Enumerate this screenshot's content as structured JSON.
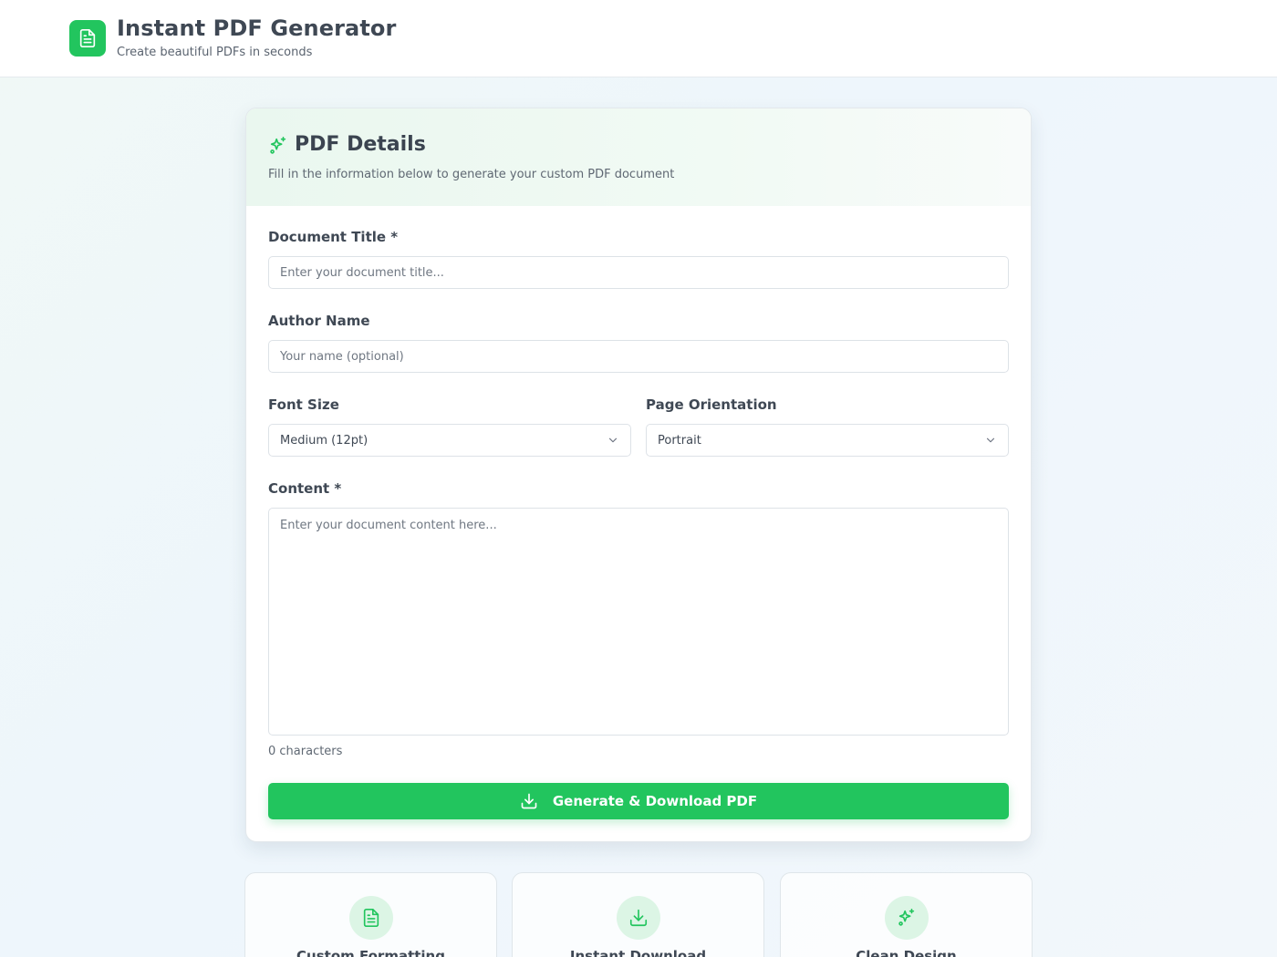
{
  "header": {
    "title": "Instant PDF Generator",
    "subtitle": "Create beautiful PDFs in seconds",
    "logo_icon": "document-icon"
  },
  "form": {
    "heading": "PDF Details",
    "heading_icon": "sparkles-icon",
    "description": "Fill in the information below to generate your custom PDF document",
    "title_label": "Document Title *",
    "title_value": "",
    "title_placeholder": "Enter your document title...",
    "author_label": "Author Name",
    "author_value": "",
    "author_placeholder": "Your name (optional)",
    "font_size_label": "Font Size",
    "font_size_value": "Medium (12pt)",
    "orientation_label": "Page Orientation",
    "orientation_value": "Portrait",
    "content_label": "Content *",
    "content_value": "",
    "content_placeholder": "Enter your document content here...",
    "char_count": "0 characters",
    "submit_label": "Generate & Download PDF",
    "submit_icon": "download-icon"
  },
  "features": [
    {
      "label": "Custom Formatting",
      "icon": "document-icon"
    },
    {
      "label": "Instant Download",
      "icon": "download-icon"
    },
    {
      "label": "Clean Design",
      "icon": "sparkles-icon"
    }
  ],
  "colors": {
    "accent": "#22c55e",
    "accent_light": "#dcf5e5",
    "text_primary": "#3f4854",
    "text_muted": "#5f6873"
  }
}
